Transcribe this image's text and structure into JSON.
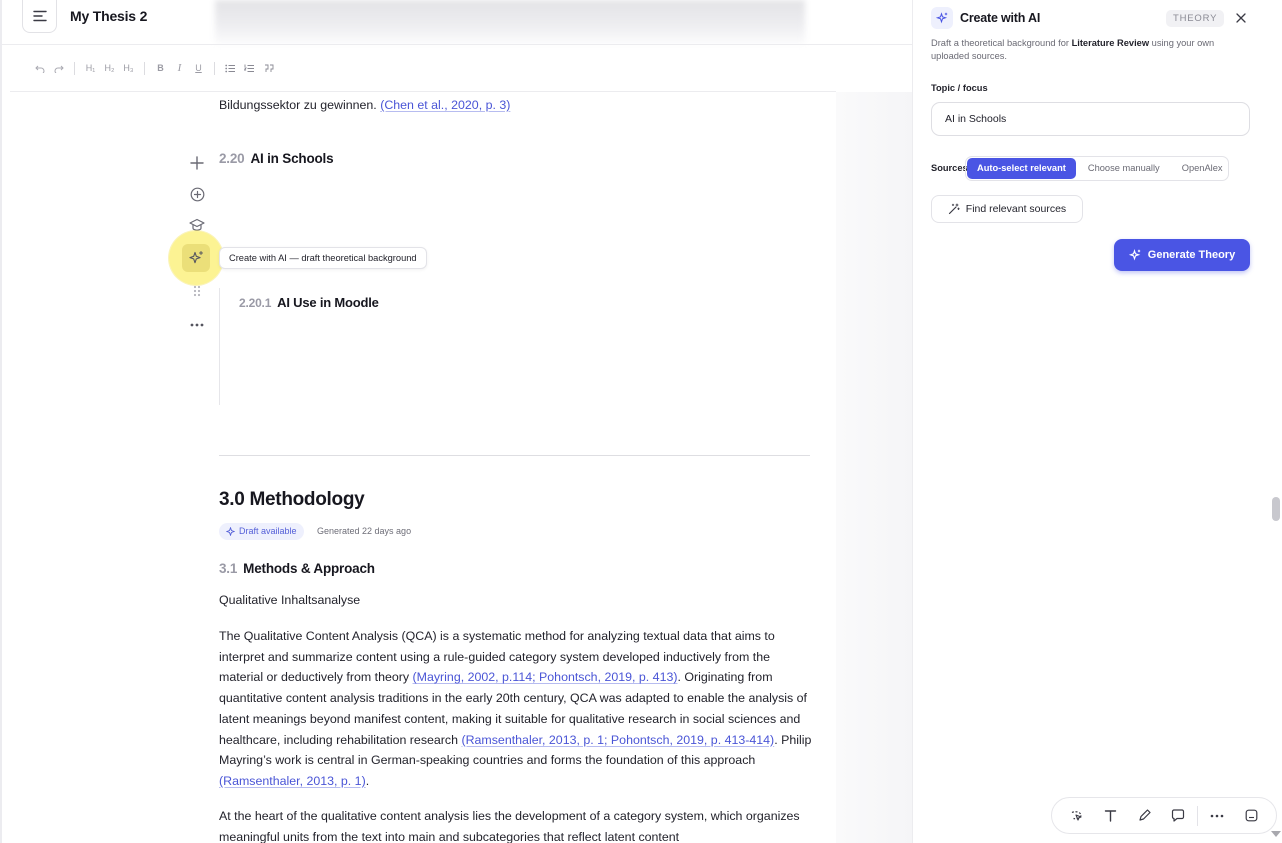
{
  "header": {
    "menu_icon": "menu-icon",
    "doc_title": "My Thesis 2"
  },
  "toolbar": {
    "undo_icon": "undo-icon",
    "redo_icon": "redo-icon",
    "h1": "H₁",
    "h2": "H₂",
    "h3": "H₃",
    "bold": "B",
    "italic": "I",
    "underline": "U",
    "bullet_list_icon": "bullet-list-icon",
    "numbered_list_icon": "numbered-list-icon",
    "quote_icon": "quote-icon"
  },
  "editor": {
    "intro_text": "Bildungssektor zu gewinnen. ",
    "intro_cite": "(Chen et al., 2020, p. 3)",
    "sec_2_20": {
      "num": "2.20",
      "title": "AI in Schools"
    },
    "sec_2_20_1": {
      "num": "2.20.1",
      "title": "AI Use in Moodle"
    },
    "gutter_tooltip": "Create with AI — draft theoretical background",
    "methodology_title": "3.0 Methodology",
    "draft_badge": "Draft available",
    "generated": "Generated 22 days ago",
    "sec_3_1": {
      "num": "3.1",
      "title": "Methods & Approach"
    },
    "subtitle": "Qualitative Inhaltsanalyse",
    "p1": {
      "a": "The Qualitative Content Analysis (QCA) is a systematic method for analyzing textual data that aims to interpret and summarize content using a rule-guided category system developed inductively from the material or deductively from theory ",
      "cite1": "(Mayring, 2002, p.114; Pohontsch, 2019, p. 413)",
      "b": ". Originating from quantitative content analysis traditions in the early 20th century, QCA was adapted to enable the analysis of latent meanings beyond manifest content, making it suitable for qualitative research in social sciences and healthcare, including rehabilitation research ",
      "cite2": "(Ramsenthaler, 2013, p. 1; Pohontsch, 2019, p. 413-414)",
      "c": ". Philip Mayring’s work is central in German-speaking countries and forms the foundation of this approach ",
      "cite3": "(Ramsenthaler, 2013, p. 1)",
      "d": "."
    },
    "p2": "At the heart of the qualitative content analysis lies the development of a category system, which organizes meaningful units from the text into main and subcategories that reflect latent content"
  },
  "panel": {
    "title": "Create with AI",
    "tag": "THEORY",
    "desc_a": "Draft a theoretical background for ",
    "desc_b": "Literature Review",
    "desc_c": " using your own uploaded sources.",
    "topic_label": "Topic / focus",
    "topic_value": "AI in Schools",
    "sources_label": "Sources",
    "source_options": [
      "Auto-select relevant",
      "Choose manually",
      "OpenAlex"
    ],
    "find_button": "Find relevant sources",
    "generate_button": "Generate Theory"
  },
  "bottom_toolbar": [
    "lasso-icon",
    "text-icon",
    "pen-icon",
    "comment-icon",
    "more-icon",
    "panel-icon"
  ],
  "colors": {
    "accent": "#4a55e4",
    "highlight": "#faec50",
    "cite": "#4a55d6"
  }
}
